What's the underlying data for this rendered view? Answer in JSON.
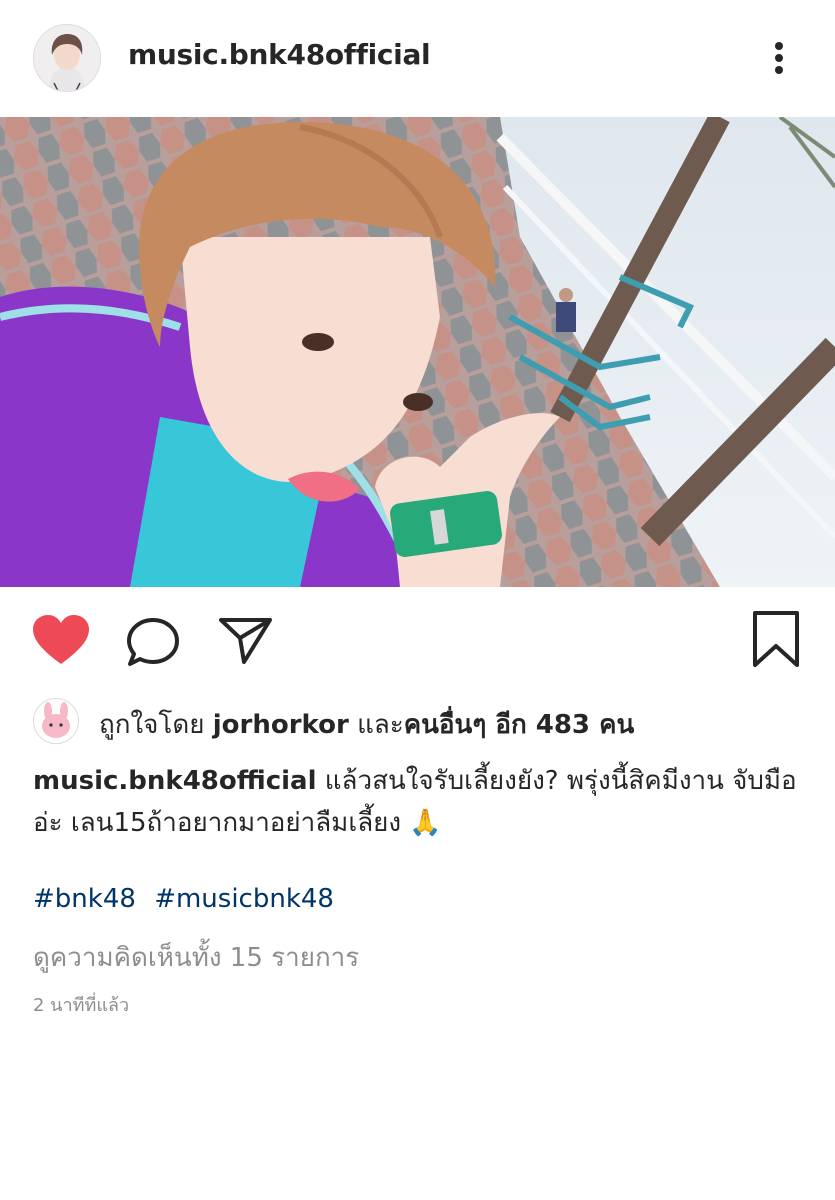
{
  "post": {
    "username": "music.bnk48official",
    "more_icon": "more-vertical-icon"
  },
  "actions": {
    "like_icon": "heart-filled-icon",
    "comment_icon": "comment-icon",
    "share_icon": "paper-plane-icon",
    "save_icon": "bookmark-icon",
    "like_color": "#ed4956"
  },
  "likes": {
    "prefix": "ถูกใจโดย",
    "user": "jorhorkor",
    "and": "และ",
    "others": "คนอื่นๆ อีก 483 คน"
  },
  "caption": {
    "user": "music.bnk48official",
    "text": "แล้วสนใจรับเลี้ยงยัง? พรุ่งนี้สิคมีงาน จับมืออ่ะ เลน15ถ้าอยากมาอย่าลืมเลี้ยง 🙏"
  },
  "hashtags": [
    "#bnk48",
    "#musicbnk48"
  ],
  "comments_link": "ดูความคิดเห็นทั้ง 15 รายการ",
  "timestamp": "2 นาทีที่แล้ว"
}
